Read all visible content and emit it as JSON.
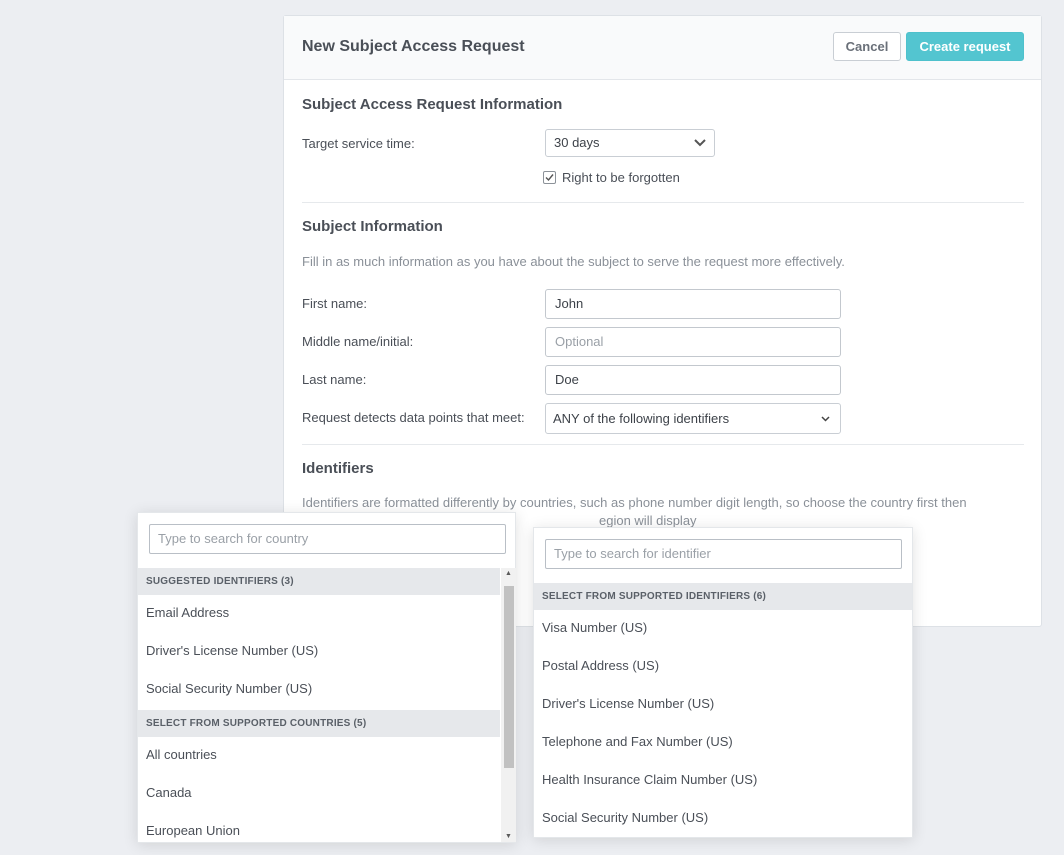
{
  "header": {
    "title": "New Subject Access Request",
    "cancel": "Cancel",
    "create": "Create request"
  },
  "sar_info": {
    "title": "Subject Access Request Information",
    "target_label": "Target service time:",
    "target_value": "30 days",
    "forgotten_label": "Right to be forgotten",
    "forgotten_checked": true
  },
  "subject": {
    "title": "Subject Information",
    "hint": "Fill in as much information as you have about the subject to serve the request more effectively.",
    "first_label": "First name:",
    "first_value": "John",
    "middle_label": "Middle name/initial:",
    "middle_placeholder": "Optional",
    "last_label": "Last name:",
    "last_value": "Doe",
    "detect_label": "Request detects data points that meet:",
    "detect_value": "ANY of the following identifiers"
  },
  "identifiers": {
    "title": "Identifiers",
    "hint_line1": "Identifiers are formatted differently by countries, such as phone number digit length, so choose the country first then",
    "hint_line2_tail": "egion will display"
  },
  "country_dropdown": {
    "search_placeholder": "Type to search for country",
    "group1": "SUGGESTED IDENTIFIERS (3)",
    "group1_items": [
      "Email Address",
      "Driver's License Number (US)",
      "Social Security Number (US)"
    ],
    "group2": "SELECT FROM SUPPORTED COUNTRIES (5)",
    "group2_items": [
      "All countries",
      "Canada",
      "European Union"
    ]
  },
  "identifier_dropdown": {
    "search_placeholder": "Type to search for identifier",
    "group": "SELECT FROM SUPPORTED IDENTIFIERS (6)",
    "items": [
      "Visa Number (US)",
      "Postal Address (US)",
      "Driver's License Number (US)",
      "Telephone and Fax Number (US)",
      "Health Insurance Claim Number (US)",
      "Social Security Number (US)"
    ]
  },
  "colors": {
    "accent": "#53c5d0",
    "background": "#eceef2",
    "group_bg": "#e6e8eb"
  }
}
